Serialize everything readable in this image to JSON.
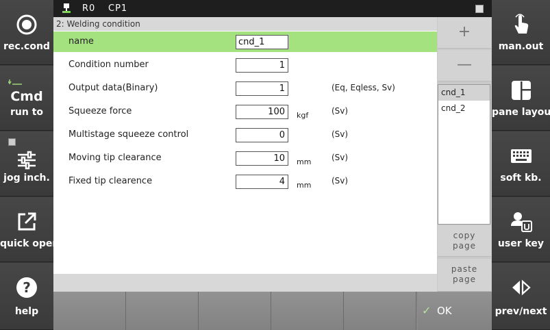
{
  "left_buttons": [
    {
      "label": "rec.cond",
      "icon": "record-icon"
    },
    {
      "label": "Cmd",
      "sub": "run to",
      "icon": "cmd-icon"
    },
    {
      "label": "jog inch.",
      "icon": "sliders-icon"
    },
    {
      "label": "quick open",
      "icon": "external-link-icon"
    },
    {
      "label": "help",
      "icon": "question-icon"
    }
  ],
  "right_buttons": [
    {
      "label": "man.out",
      "icon": "hand-pointer-icon"
    },
    {
      "label": "pane layout",
      "icon": "layout-icon"
    },
    {
      "label": "soft kb.",
      "icon": "keyboard-icon"
    },
    {
      "label": "user key",
      "icon": "user-key-icon"
    },
    {
      "label": "prev/next",
      "icon": "prev-next-icon"
    }
  ],
  "status": {
    "robot": "R0",
    "cp": "CP1"
  },
  "page": {
    "title": "2: Welding condition"
  },
  "rows": [
    {
      "name": "name",
      "value": "cnd_1",
      "unit": "",
      "note": ""
    },
    {
      "name": "Condition number",
      "value": "1",
      "unit": "",
      "note": ""
    },
    {
      "name": "Output data(Binary)",
      "value": "1",
      "unit": "",
      "note": "(Eq, Eqless, Sv)"
    },
    {
      "name": "Squeeze force",
      "value": "100",
      "unit": "kgf",
      "note": "(Sv)"
    },
    {
      "name": "Multistage squeeze control",
      "value": "0",
      "unit": "",
      "note": "(Sv)"
    },
    {
      "name": "Moving tip clearance",
      "value": "10",
      "unit": "mm",
      "note": "(Sv)"
    },
    {
      "name": "Fixed tip clearence",
      "value": "4",
      "unit": "mm",
      "note": "(Sv)"
    }
  ],
  "list": {
    "add": "+",
    "remove": "—",
    "items": [
      "cnd_1",
      "cnd_2"
    ],
    "copy": [
      "copy",
      "page"
    ],
    "paste": [
      "paste",
      "page"
    ]
  },
  "footer": {
    "ok": "OK",
    "ok_icon": "check-icon"
  },
  "colors": {
    "highlight": "#a4e27f",
    "panel": "#3a3a3a"
  }
}
